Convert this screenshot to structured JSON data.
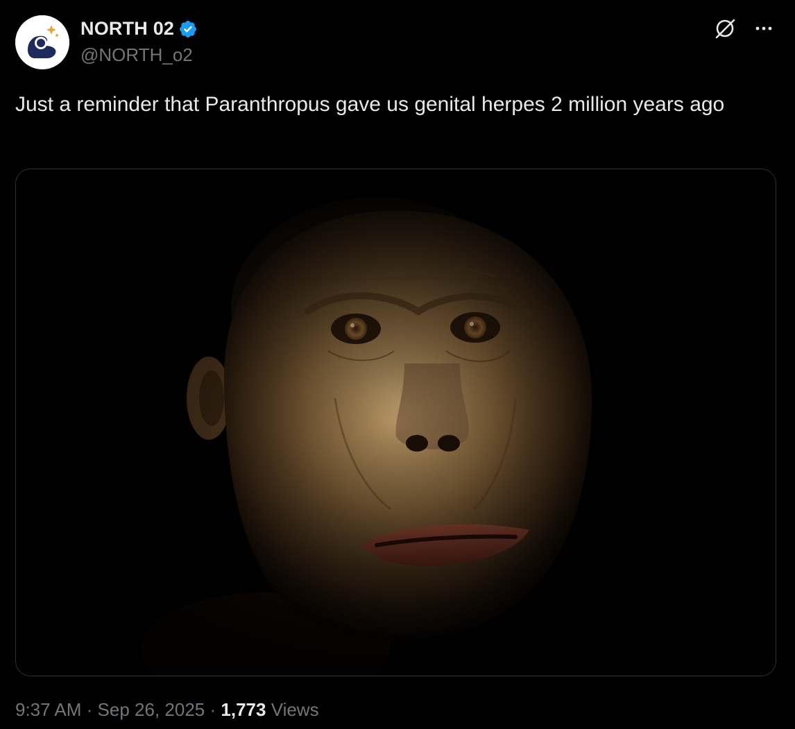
{
  "author": {
    "display_name": "NORTH 02",
    "handle": "@NORTH_o2",
    "verified": true,
    "verified_color": "#1d9bf0",
    "avatar_icon": "globe-hand-logo-icon"
  },
  "actions": {
    "grok_icon": "grok-icon",
    "more_icon": "more-horizontal-icon"
  },
  "tweet": {
    "text": "Just a reminder that Paranthropus gave us genital herpes 2 million years ago"
  },
  "media": {
    "type": "photo"
  },
  "meta": {
    "time": "9:37 AM",
    "separator": "·",
    "date": "Sep 26, 2025",
    "views_count": "1,773",
    "views_label": "Views"
  },
  "colors": {
    "background": "#000000",
    "text_primary": "#e7e9ea",
    "text_secondary": "#71767b",
    "border": "#2f3336"
  }
}
